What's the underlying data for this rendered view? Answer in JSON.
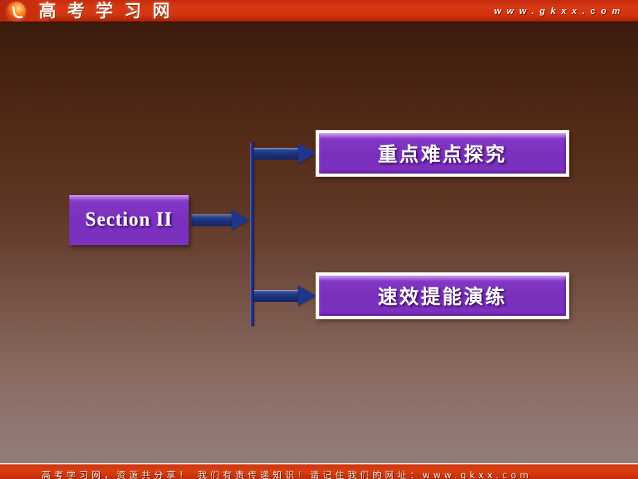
{
  "banner": {
    "logo_icon": "gkxx-circle-logo-icon",
    "brand_text": "高考学习网",
    "site_url": "www.gkxx.com"
  },
  "diagram": {
    "section_node": {
      "label": "Section II"
    },
    "branches": [
      {
        "label": "重点难点探究"
      },
      {
        "label": "速效提能演练"
      }
    ],
    "connectors": {
      "trunk_arrow": "arrow-right-icon",
      "branch_top_arrow": "arrow-right-icon",
      "branch_bottom_arrow": "arrow-right-icon",
      "vertical_bar": "vertical-connector-bar"
    }
  },
  "footer": {
    "text": "高考学习网，资源共分享！ 我们有责传递知识！请记住我们的网址：www.gkxx.com"
  },
  "colors": {
    "banner_red": "#d2330f",
    "node_purple": "#7a2fbd",
    "arrow_navy": "#20358b",
    "background_top": "#2e1308",
    "background_bottom": "#94807c"
  }
}
